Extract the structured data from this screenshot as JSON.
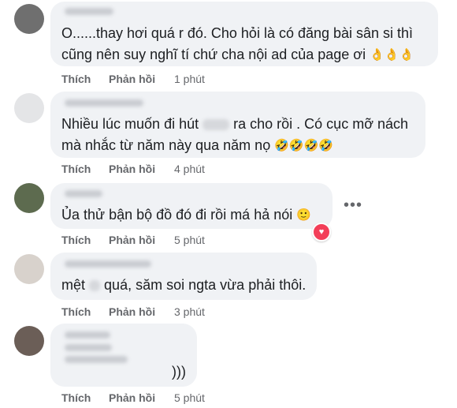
{
  "comments": [
    {
      "lines": [
        "O......thay hơi quá r đó. Cho hỏi là có đăng bài sân si thì",
        "cũng nên suy nghĩ tí chứ cha nội ad của page ơi"
      ],
      "emoji": "👌👌👌",
      "like": "Thích",
      "reply": "Phản hồi",
      "time": "1 phút"
    },
    {
      "lines": [
        "Nhiều lúc muốn đi hút",
        "ra cho rồi . Có cục mỡ nách",
        "mà nhắc từ năm này qua năm nọ"
      ],
      "emoji": "🤣🤣🤣🤣",
      "like": "Thích",
      "reply": "Phản hồi",
      "time": "4 phút"
    },
    {
      "lines": [
        "Ủa thử bận bộ đồ đó đi rồi má hả nói"
      ],
      "emoji": "🙂",
      "like": "Thích",
      "reply": "Phản hồi",
      "time": "5 phút"
    },
    {
      "lines": [
        "mệt",
        "quá, săm soi ngta vừa phải thôi."
      ],
      "like": "Thích",
      "reply": "Phản hồi",
      "time": "3 phút"
    },
    {
      "lines": [
        ")))"
      ],
      "like": "Thích",
      "reply": "Phản hồi",
      "time": "5 phút"
    }
  ],
  "more_options": "•••",
  "reaction_icon": "heart-reaction-icon",
  "colors": {
    "bubble": "#f0f2f5",
    "meta": "#65676b",
    "text": "#1c1e21",
    "heart": "#f33e58"
  }
}
